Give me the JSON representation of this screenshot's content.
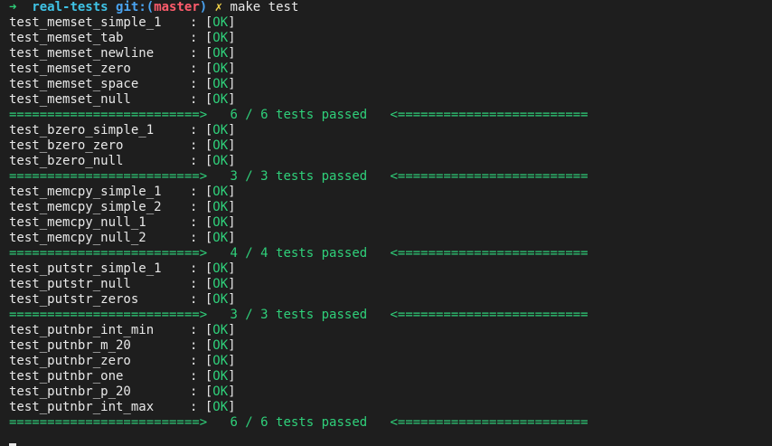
{
  "prompt": {
    "arrow": "➜",
    "dir": "real-tests",
    "git_label": "git:(",
    "branch": "master",
    "git_close": ")",
    "dirty": "✗",
    "command": "make test"
  },
  "groups": [
    {
      "tests": [
        {
          "name": "test_memset_simple_1",
          "result": "OK"
        },
        {
          "name": "test_memset_tab",
          "result": "OK"
        },
        {
          "name": "test_memset_newline",
          "result": "OK"
        },
        {
          "name": "test_memset_zero",
          "result": "OK"
        },
        {
          "name": "test_memset_space",
          "result": "OK"
        },
        {
          "name": "test_memset_null",
          "result": "OK"
        }
      ],
      "summary": "6 / 6 tests passed"
    },
    {
      "tests": [
        {
          "name": "test_bzero_simple_1",
          "result": "OK"
        },
        {
          "name": "test_bzero_zero",
          "result": "OK"
        },
        {
          "name": "test_bzero_null",
          "result": "OK"
        }
      ],
      "summary": "3 / 3 tests passed"
    },
    {
      "tests": [
        {
          "name": "test_memcpy_simple_1",
          "result": "OK"
        },
        {
          "name": "test_memcpy_simple_2",
          "result": "OK"
        },
        {
          "name": "test_memcpy_null_1",
          "result": "OK"
        },
        {
          "name": "test_memcpy_null_2",
          "result": "OK"
        }
      ],
      "summary": "4 / 4 tests passed"
    },
    {
      "tests": [
        {
          "name": "test_putstr_simple_1",
          "result": "OK"
        },
        {
          "name": "test_putstr_null",
          "result": "OK"
        },
        {
          "name": "test_putstr_zeros",
          "result": "OK"
        }
      ],
      "summary": "3 / 3 tests passed"
    },
    {
      "tests": [
        {
          "name": "test_putnbr_int_min",
          "result": "OK"
        },
        {
          "name": "test_putnbr_m_20",
          "result": "OK"
        },
        {
          "name": "test_putnbr_zero",
          "result": "OK"
        },
        {
          "name": "test_putnbr_one",
          "result": "OK"
        },
        {
          "name": "test_putnbr_p_20",
          "result": "OK"
        },
        {
          "name": "test_putnbr_int_max",
          "result": "OK"
        }
      ],
      "summary": "6 / 6 tests passed"
    }
  ],
  "separator": {
    "left": "=========================>",
    "right": "<========================="
  },
  "colors": {
    "background": "#1e1e1e",
    "ok_green": "#2fd07a",
    "text": "#e8e8e8",
    "dir_cyan": "#3fc3e6",
    "branch_red": "#ff5c6c",
    "dirty_yellow": "#f3d34a"
  }
}
